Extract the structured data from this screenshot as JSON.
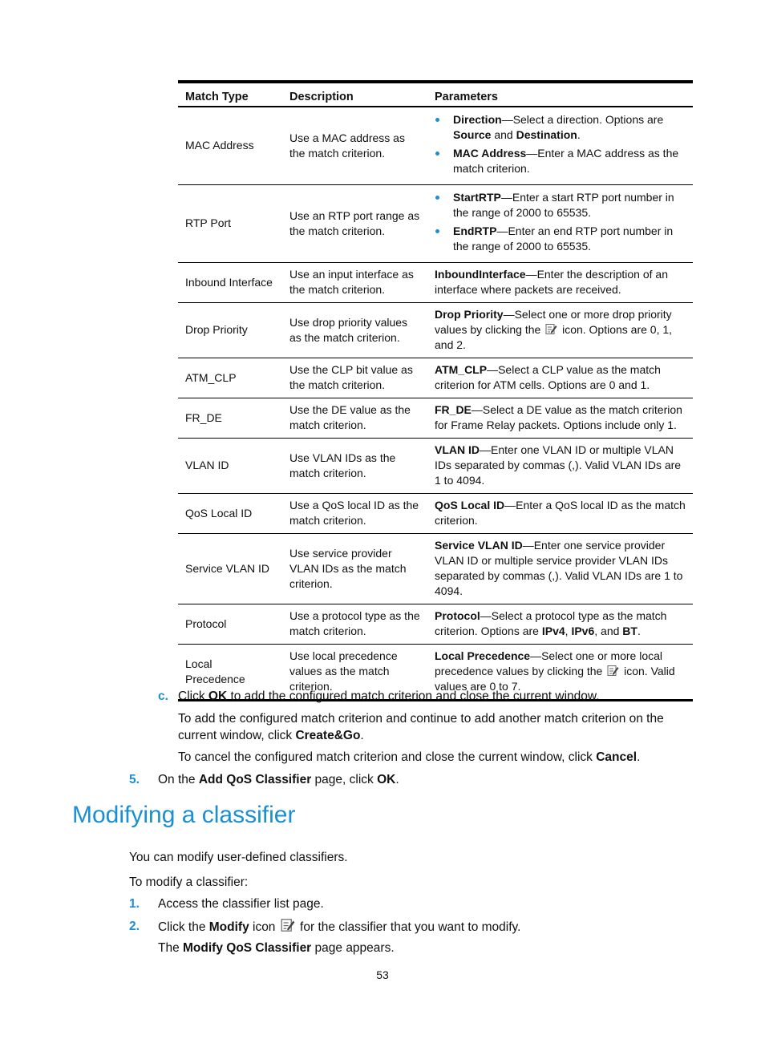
{
  "table": {
    "headers": [
      "Match Type",
      "Description",
      "Parameters"
    ],
    "rows": [
      {
        "type": "MAC Address",
        "description": "Use a MAC address as the match criterion.",
        "bullets": [
          {
            "term": "Direction",
            "text": "—Select a direction. Options are ",
            "opt1": "Source",
            "mid": " and ",
            "opt2": "Destination",
            "end": "."
          },
          {
            "term": "MAC Address",
            "text": "—Enter a MAC address as the match criterion."
          }
        ]
      },
      {
        "type": "RTP Port",
        "description": "Use an RTP port range as the match criterion.",
        "bullets": [
          {
            "term": "StartRTP",
            "text": "—Enter a start RTP port number in the range of 2000 to 65535."
          },
          {
            "term": "EndRTP",
            "text": "—Enter an end RTP port number in the range of 2000 to 65535."
          }
        ]
      },
      {
        "type": "Inbound Interface",
        "description": "Use an input interface as the match criterion.",
        "term": "InboundInterface",
        "text": "—Enter the description of an interface where packets are received."
      },
      {
        "type": "Drop Priority",
        "description": "Use drop priority values as the match criterion.",
        "term": "Drop Priority",
        "text": "—Select one or more drop priority values by clicking the ",
        "text_after_icon": " icon. Options are 0, 1, and 2."
      },
      {
        "type": "ATM_CLP",
        "description": "Use the CLP bit value as the match criterion.",
        "term": "ATM_CLP",
        "text": "—Select a CLP value as the match criterion for ATM cells. Options are 0 and 1."
      },
      {
        "type": "FR_DE",
        "description": "Use the DE value as the match criterion.",
        "term": "FR_DE",
        "text": "—Select a DE value as the match criterion for Frame Relay packets. Options include only 1."
      },
      {
        "type": "VLAN ID",
        "description": "Use VLAN IDs as the match criterion.",
        "term": "VLAN ID",
        "text": "—Enter one VLAN ID or multiple VLAN IDs separated by commas (,). Valid VLAN IDs are 1 to 4094."
      },
      {
        "type": "QoS Local ID",
        "description": "Use a QoS local ID as the match criterion.",
        "term": "QoS Local ID",
        "text": "—Enter a QoS local ID as the match criterion."
      },
      {
        "type": "Service VLAN ID",
        "description": "Use service provider VLAN IDs as the match criterion.",
        "term": "Service VLAN ID",
        "text": "—Enter one service provider VLAN ID or multiple service provider VLAN IDs separated by commas (,). Valid VLAN IDs are 1 to 4094."
      },
      {
        "type": "Protocol",
        "description": "Use a protocol type as the match criterion.",
        "term": "Protocol",
        "text": "—Select a protocol type as the match criterion. Options are ",
        "o1": "IPv4",
        "s1": ", ",
        "o2": "IPv6",
        "s2": ", and ",
        "o3": "BT",
        "end": "."
      },
      {
        "type": "Local Precedence",
        "description": "Use local precedence values as the match criterion.",
        "term": "Local Precedence",
        "text": "—Select one or more local precedence values by clicking the ",
        "text_after_icon": " icon. Valid values are 0 to 7."
      }
    ]
  },
  "step_c": {
    "marker": "c.",
    "l1_a": "Click ",
    "l1_b": "OK",
    "l1_c": " to add the configured match criterion and close the current window.",
    "p2_a": "To add the configured match criterion and continue to add another match criterion on the",
    "p2_b": "current window, click ",
    "p2_c": "Create&Go",
    "p2_d": ".",
    "p3_a": "To cancel the configured match criterion and close the current window, click ",
    "p3_b": "Cancel",
    "p3_c": "."
  },
  "step_5": {
    "marker": "5.",
    "a": "On the ",
    "b": "Add QoS Classifier",
    "c": " page, click ",
    "d": "OK",
    "e": "."
  },
  "section": {
    "title": "Modifying a classifier",
    "intro": "You can modify user-defined classifiers.",
    "lead": "To modify a classifier:",
    "steps": [
      {
        "marker": "1.",
        "text": "Access the classifier list page."
      },
      {
        "marker": "2.",
        "a": "Click the ",
        "b": "Modify",
        "c": " icon ",
        "d": " for the classifier that you want to modify."
      }
    ],
    "result_a": "The ",
    "result_b": "Modify QoS Classifier",
    "result_c": " page appears."
  },
  "page_number": "53"
}
